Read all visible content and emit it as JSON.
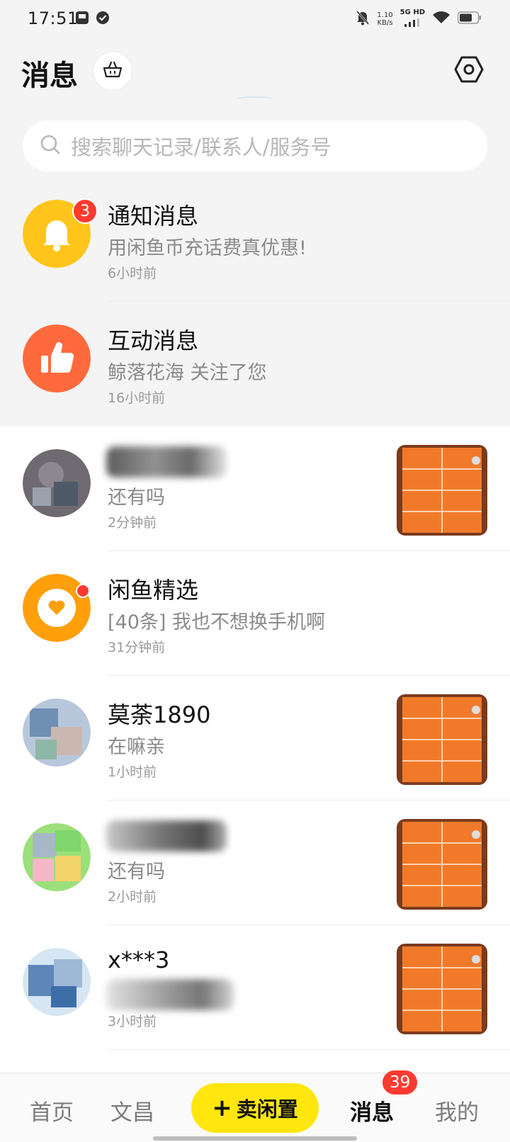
{
  "status_bar": {
    "time": "17:51",
    "net_speed_value": "1.10",
    "net_speed_unit": "KB/s",
    "network": "5G HD",
    "icons": [
      "gallery-icon",
      "check-circle-icon",
      "mute-icon",
      "signal-icon",
      "wifi-icon",
      "battery-icon"
    ]
  },
  "header": {
    "title": "消息",
    "basket_icon": "basket-icon",
    "settings_icon": "hexagon-settings-icon"
  },
  "search": {
    "placeholder": "搜索聊天记录/联系人/服务号"
  },
  "conversations": [
    {
      "name": "通知消息",
      "preview": "用闲鱼币充话费真优惠!",
      "time": "6小时前",
      "badge": "3",
      "avatar": "bell-icon",
      "color": "#ffc51a"
    },
    {
      "name": "互动消息",
      "preview": "鲸落花海 关注了您",
      "time": "16小时前",
      "avatar": "thumbs-up-icon",
      "color": "#ff6a3d"
    },
    {
      "name": "",
      "preview": "还有吗",
      "time": "2分钟前",
      "avatar": "user-avatar"
    },
    {
      "name": "闲鱼精选",
      "preview": "[40条] 我也不想换手机啊",
      "time": "31分钟前",
      "avatar": "heart-icon",
      "color": "#ff9f0a"
    },
    {
      "name": "莫荼1890",
      "preview": "在嘛亲",
      "time": "1小时前",
      "avatar": "user-avatar"
    },
    {
      "name": "",
      "preview": "还有吗",
      "time": "2小时前",
      "avatar": "user-avatar"
    },
    {
      "name": "x***3",
      "preview": "",
      "time": "3小时前",
      "avatar": "user-avatar"
    }
  ],
  "tabbar": {
    "home": "首页",
    "wenchang": "文昌",
    "sell": "卖闲置",
    "messages": "消息",
    "messages_badge": "39",
    "mine": "我的"
  }
}
